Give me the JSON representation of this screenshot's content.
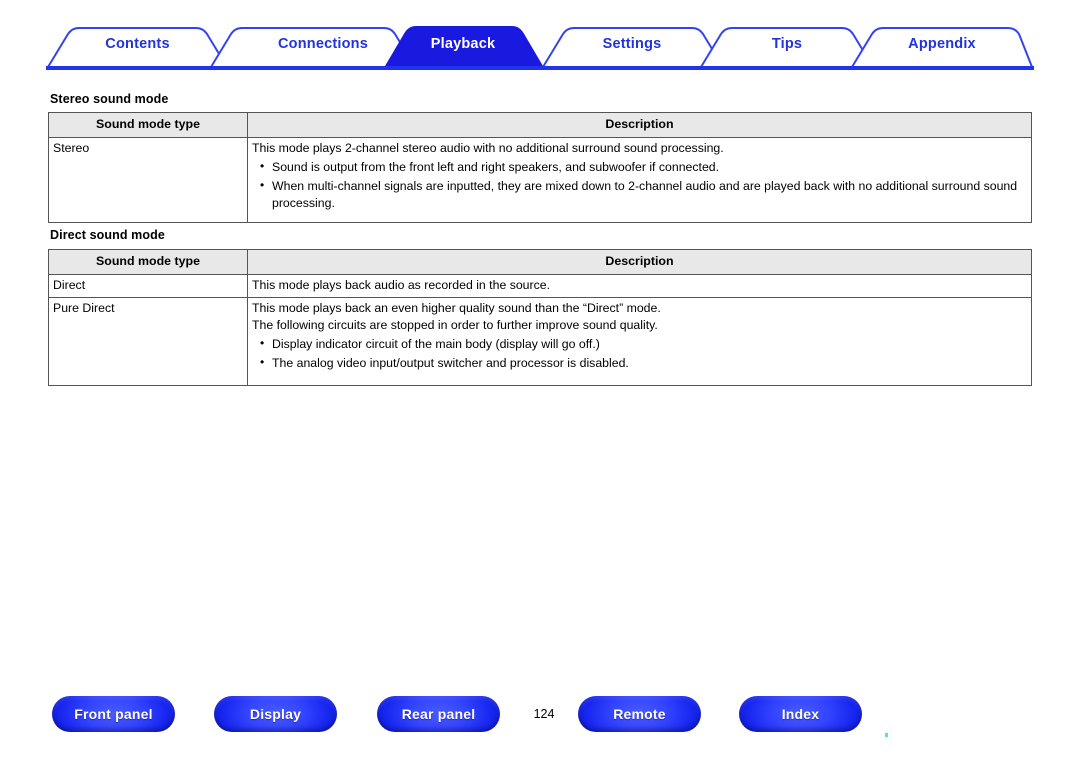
{
  "document": {
    "page_number": "124"
  },
  "tabbar": {
    "active_color": "#1919E0",
    "outline_color": "#2233DD",
    "tabs": [
      {
        "label": "Contents",
        "active": false
      },
      {
        "label": "Connections",
        "active": false
      },
      {
        "label": "Playback",
        "active": true
      },
      {
        "label": "Settings",
        "active": false
      },
      {
        "label": "Tips",
        "active": false
      },
      {
        "label": "Appendix",
        "active": false
      }
    ]
  },
  "sections": [
    {
      "title": "Stereo sound mode",
      "columns": [
        "Sound mode type",
        "Description"
      ],
      "rows": [
        {
          "type": "Stereo",
          "lead": "This mode plays 2-channel stereo audio with no additional surround sound processing.",
          "bullets": [
            "Sound is output from the front left and right speakers, and subwoofer if connected.",
            "When multi-channel signals are inputted, they are mixed down to 2-channel audio and are played back with no additional surround sound processing."
          ]
        }
      ]
    },
    {
      "title": "Direct sound mode",
      "columns": [
        "Sound mode type",
        "Description"
      ],
      "rows": [
        {
          "type": "Direct",
          "lead": "This mode plays back audio as recorded in the source.",
          "bullets": []
        },
        {
          "type": "Pure Direct",
          "lead": "This mode plays back an even higher quality sound than the “Direct” mode.",
          "lead2": "The following circuits are stopped in order to further improve sound quality.",
          "bullets": [
            "Display indicator circuit of the main body (display will go off.)",
            "The analog video input/output switcher and processor is disabled."
          ]
        }
      ]
    }
  ],
  "footer": {
    "buttons": [
      {
        "label": "Front panel"
      },
      {
        "label": "Display"
      },
      {
        "label": "Rear panel"
      },
      {
        "label": "Remote"
      },
      {
        "label": "Index"
      }
    ]
  }
}
